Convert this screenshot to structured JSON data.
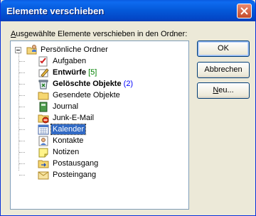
{
  "window": {
    "title": "Elemente verschieben"
  },
  "prompt": {
    "prefix": "A",
    "rest": "usgewählte Elemente verschieben in den Ordner:"
  },
  "tree": {
    "root": {
      "label": "Persönliche Ordner",
      "icon": "personal-folders-icon"
    },
    "items": [
      {
        "label": "Aufgaben",
        "icon": "tasks-icon",
        "bold": false
      },
      {
        "label": "Entwürfe",
        "count": "[5]",
        "count_color": "#008000",
        "icon": "drafts-icon",
        "bold": true
      },
      {
        "label": "Gelöschte Objekte",
        "count": "(2)",
        "count_color": "#0000ff",
        "icon": "deleted-items-icon",
        "bold": true
      },
      {
        "label": "Gesendete Objekte",
        "icon": "sent-items-icon",
        "bold": false
      },
      {
        "label": "Journal",
        "icon": "journal-icon",
        "bold": false
      },
      {
        "label": "Junk-E-Mail",
        "icon": "junk-mail-icon",
        "bold": false
      },
      {
        "label": "Kalender",
        "icon": "calendar-icon",
        "bold": false,
        "selected": true
      },
      {
        "label": "Kontakte",
        "icon": "contacts-icon",
        "bold": false
      },
      {
        "label": "Notizen",
        "icon": "notes-icon",
        "bold": false
      },
      {
        "label": "Postausgang",
        "icon": "outbox-icon",
        "bold": false
      },
      {
        "label": "Posteingang",
        "icon": "inbox-icon",
        "bold": false
      }
    ]
  },
  "buttons": {
    "ok": "OK",
    "cancel": "Abbrechen",
    "new_prefix": "N",
    "new_rest": "eu..."
  },
  "colors": {
    "selection": "#316ac5",
    "titlebar": "#0458d8"
  }
}
